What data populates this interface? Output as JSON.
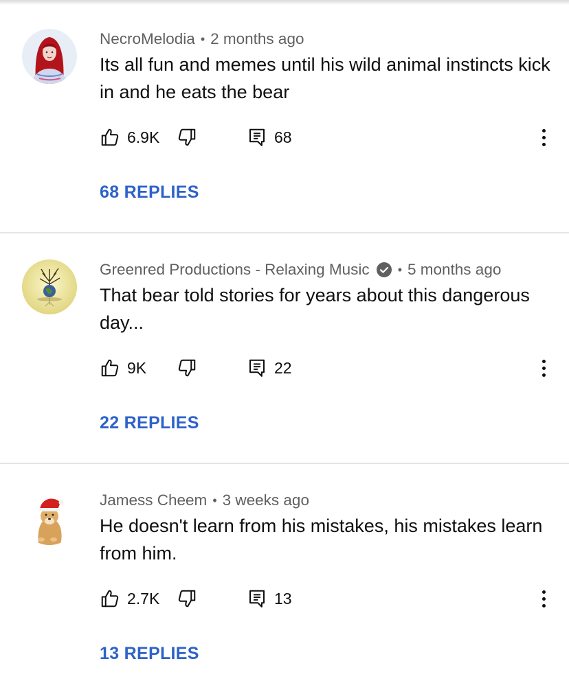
{
  "comments": [
    {
      "author": "NecroMelodia",
      "time": "2 months ago",
      "text": "Its all fun and memes until his wild animal instincts kick in and he eats the bear",
      "likes": "6.9K",
      "reply_count": "68",
      "replies_label": "68 REPLIES",
      "verified": false,
      "avatar": "woman-red-hair-avatar"
    },
    {
      "author": "Greenred Productions - Relaxing Music",
      "time": "5 months ago",
      "text": "That bear told stories for years about this dangerous day...",
      "likes": "9K",
      "reply_count": "22",
      "replies_label": "22 REPLIES",
      "verified": true,
      "avatar": "tree-globe-avatar"
    },
    {
      "author": "Jamess Cheem",
      "time": "3 weeks ago",
      "text": "He doesn't learn from his mistakes, his mistakes learn from him.",
      "likes": "2.7K",
      "reply_count": "13",
      "replies_label": "13 REPLIES",
      "verified": false,
      "avatar": "santa-hat-doge-avatar"
    }
  ],
  "icons": {
    "like": "thumbs-up-icon",
    "dislike": "thumbs-down-icon",
    "reply": "comment-icon",
    "more": "more-vertical-icon",
    "verified": "verified-check-icon"
  },
  "colors": {
    "link": "#2e62c9",
    "meta_text": "#606060",
    "body_text": "#0f0f0f",
    "divider": "#e5e5e5"
  },
  "dot_separator": "•"
}
